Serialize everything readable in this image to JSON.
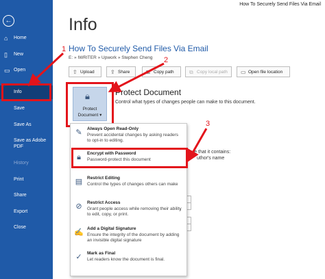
{
  "window": {
    "title": "How To Securely Send Files Via Email"
  },
  "sidebar": {
    "back_icon": "back-arrow-icon",
    "items": [
      {
        "label": "Home",
        "icon": "home-icon"
      },
      {
        "label": "New",
        "icon": "new-document-icon"
      },
      {
        "label": "Open",
        "icon": "open-folder-icon"
      },
      {
        "label": "Info"
      },
      {
        "label": "Save"
      },
      {
        "label": "Save As"
      },
      {
        "label": "Save as Adobe",
        "label2": "PDF"
      },
      {
        "label": "History"
      },
      {
        "label": "Print"
      },
      {
        "label": "Share"
      },
      {
        "label": "Export"
      },
      {
        "label": "Close"
      }
    ]
  },
  "main": {
    "page_title": "Info",
    "doc_title": "How To Securely Send Files Via Email",
    "breadcrumb": "E: » IWRITER » Upwork » Stephen Cheng",
    "buttons": {
      "upload": "Upload",
      "share": "Share",
      "copy_path": "Copy path",
      "copy_local_path": "Copy local path",
      "open_file_location": "Open file location"
    },
    "protect": {
      "tile_line1": "Protect",
      "tile_line2": "Document ▾",
      "title": "Protect Document",
      "description": "Control what types of changes people can make to this document."
    },
    "background_text": {
      "contains": "are that it contains:",
      "author": "uthor's name"
    }
  },
  "dropdown": {
    "items": [
      {
        "title": "Always Open Read-Only",
        "desc": "Prevent accidental changes by asking readers to opt-in to editing.",
        "icon": "read-only-icon"
      },
      {
        "title": "Encrypt with Password",
        "desc": "Password-protect this document",
        "icon": "lock-icon"
      },
      {
        "title": "Restrict Editing",
        "desc": "Control the types of changes others can make",
        "icon": "restrict-editing-icon"
      },
      {
        "title": "Restrict Access",
        "desc": "Grant people access while removing their ability to edit, copy, or print.",
        "icon": "restrict-access-icon"
      },
      {
        "title": "Add a Digital Signature",
        "desc": "Ensure the integrity of the document by adding an invisible digital signature",
        "icon": "signature-icon"
      },
      {
        "title": "Mark as Final",
        "desc": "Let readers know the document is final.",
        "icon": "mark-final-icon"
      }
    ]
  },
  "annotations": {
    "n1": "1",
    "n2": "2",
    "n3": "3",
    "color": "#e3141b"
  },
  "colors": {
    "sidebar": "#1f5aa8",
    "sidebar_active": "#123e78",
    "accent": "#1f5aa8",
    "highlight": "#e3141b"
  }
}
